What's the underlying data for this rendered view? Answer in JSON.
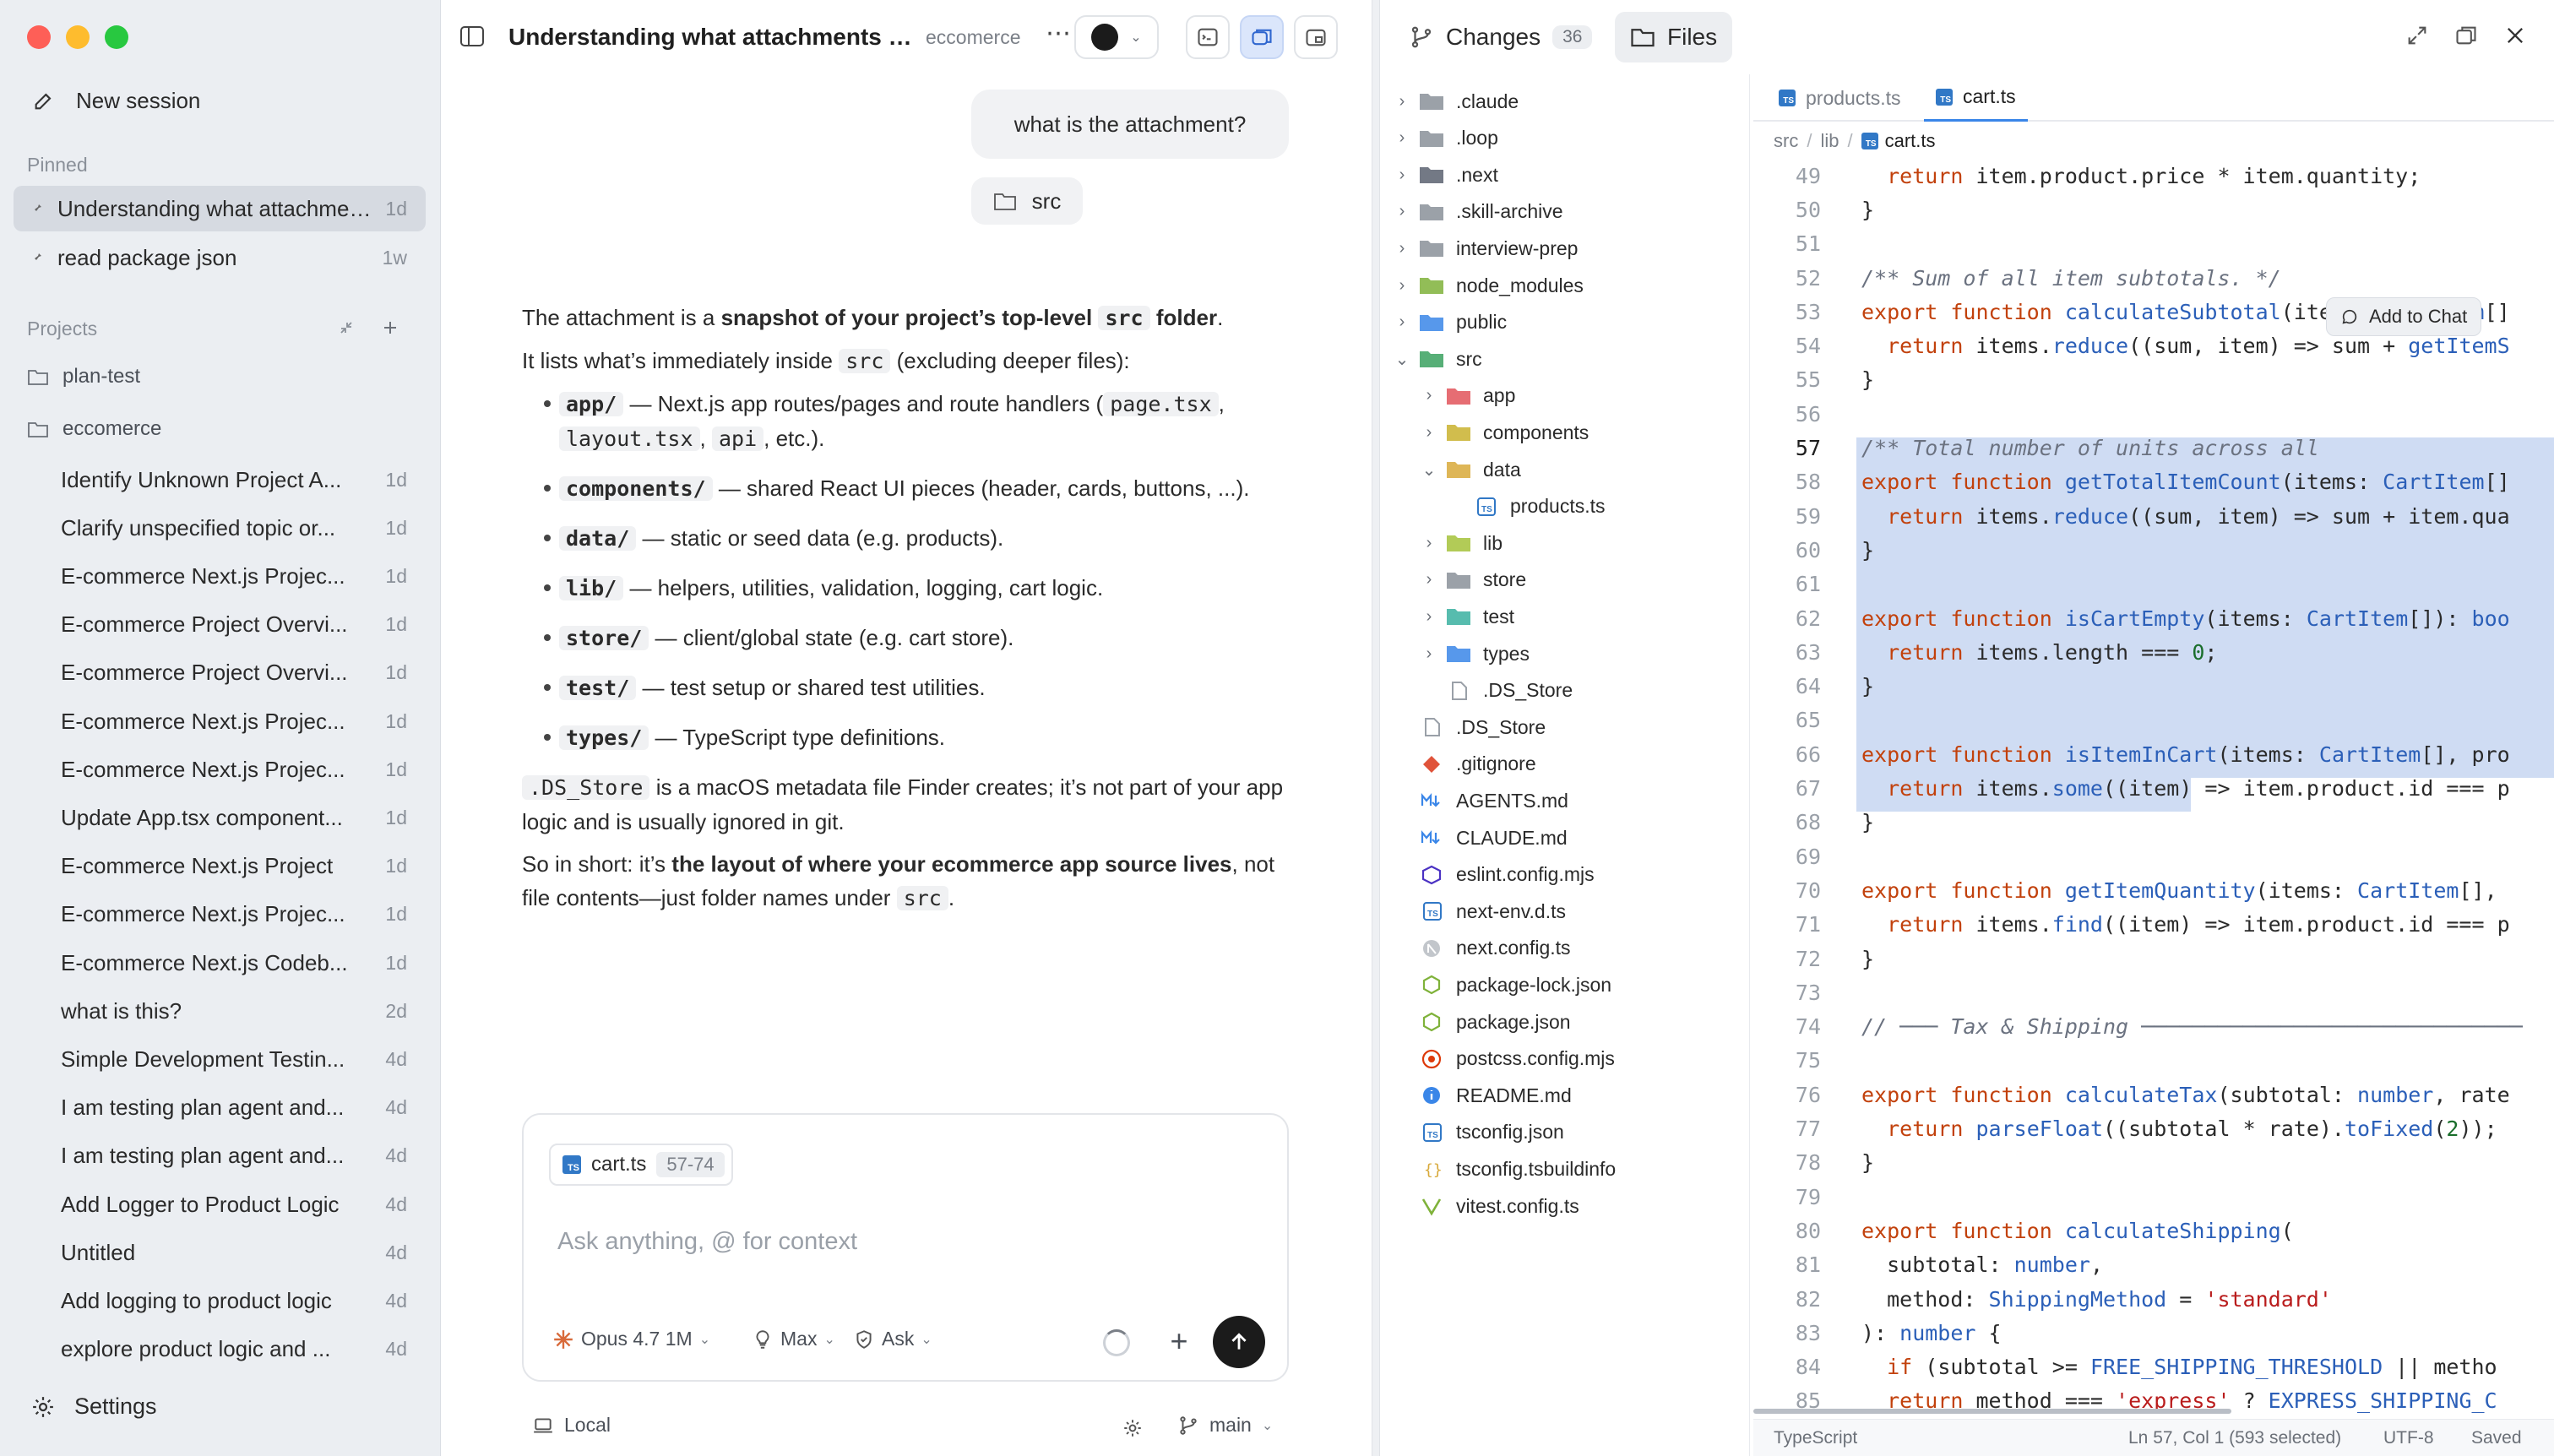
{
  "sidebar": {
    "new_session": "New session",
    "pinned_label": "Pinned",
    "pinned": [
      {
        "label": "Understanding what attachments refer to",
        "age": "1d",
        "active": true
      },
      {
        "label": "read package json",
        "age": "1w",
        "active": false
      }
    ],
    "projects_label": "Projects",
    "projects": [
      {
        "name": "plan-test"
      },
      {
        "name": "eccomerce"
      }
    ],
    "sessions": [
      {
        "label": "Identify Unknown Project A...",
        "age": "1d"
      },
      {
        "label": "Clarify unspecified topic or...",
        "age": "1d"
      },
      {
        "label": "E-commerce Next.js Projec...",
        "age": "1d"
      },
      {
        "label": "E-commerce Project Overvi...",
        "age": "1d"
      },
      {
        "label": "E-commerce Project Overvi...",
        "age": "1d"
      },
      {
        "label": "E-commerce Next.js Projec...",
        "age": "1d"
      },
      {
        "label": "E-commerce Next.js Projec...",
        "age": "1d"
      },
      {
        "label": "Update App.tsx component...",
        "age": "1d"
      },
      {
        "label": "E-commerce Next.js Project",
        "age": "1d"
      },
      {
        "label": "E-commerce Next.js Projec...",
        "age": "1d"
      },
      {
        "label": "E-commerce Next.js Codeb...",
        "age": "1d"
      },
      {
        "label": "what is this?",
        "age": "2d"
      },
      {
        "label": "Simple Development Testin...",
        "age": "4d"
      },
      {
        "label": "I am testing plan agent and...",
        "age": "4d"
      },
      {
        "label": "I am testing plan agent and...",
        "age": "4d"
      },
      {
        "label": "Add Logger to Product Logic",
        "age": "4d"
      },
      {
        "label": "Untitled",
        "age": "4d"
      },
      {
        "label": "Add logging to product logic",
        "age": "4d"
      },
      {
        "label": "explore product logic and ...",
        "age": "4d"
      }
    ],
    "settings": "Settings"
  },
  "chat": {
    "title": "Understanding what attachments re...",
    "project": "eccomerce",
    "user_message": "what is the attachment?",
    "attachment": "src",
    "answer": {
      "p1_pre": "The attachment is a ",
      "p1_bold": "snapshot of your project’s top-level",
      "p1_code": "src",
      "p1_bold2": "folder",
      "p1_end": ".",
      "p2_pre": "It lists what’s immediately inside",
      "p2_code": "src",
      "p2_post": "(excluding deeper files):",
      "items": [
        {
          "code": "app/",
          "text": "— Next.js app routes/pages and route handlers (",
          "codes": [
            "page.tsx",
            "layout.tsx",
            "api"
          ],
          "tail": ", etc.)."
        },
        {
          "code": "components/",
          "text": "— shared React UI pieces (header, cards, buttons, ...)."
        },
        {
          "code": "data/",
          "text": "— static or seed data (e.g. products)."
        },
        {
          "code": "lib/",
          "text": "— helpers, utilities, validation, logging, cart logic."
        },
        {
          "code": "store/",
          "text": "— client/global state (e.g. cart store)."
        },
        {
          "code": "test/",
          "text": "— test setup or shared test utilities."
        },
        {
          "code": "types/",
          "text": "— TypeScript type definitions."
        }
      ],
      "p3_code": ".DS_Store",
      "p3_text": "is a macOS metadata file Finder creates; it’s not part of your app logic and is usually ignored in git.",
      "p4_pre": "So in short: it’s",
      "p4_bold": "the layout of where your ecommerce app source lives",
      "p4_post": ", not file contents—just folder names under",
      "p4_code": "src",
      "p4_end": "."
    },
    "composer": {
      "context_file": "cart.ts",
      "context_range": "57-74",
      "placeholder": "Ask anything, @ for context",
      "model": "Opus 4.7 1M",
      "effort": "Max",
      "mode": "Ask"
    },
    "footer": {
      "location": "Local",
      "branch": "main"
    }
  },
  "files_panel": {
    "tabs": [
      {
        "label": "Changes",
        "count": "36"
      },
      {
        "label": "Files"
      }
    ],
    "tree": [
      {
        "name": ".claude",
        "type": "folder",
        "depth": 0,
        "expand": "closed",
        "color": "#8a9099"
      },
      {
        "name": ".loop",
        "type": "folder",
        "depth": 0,
        "expand": "closed",
        "color": "#8a9099"
      },
      {
        "name": ".next",
        "type": "folder",
        "depth": 0,
        "expand": "closed",
        "color": "#5b6270"
      },
      {
        "name": ".skill-archive",
        "type": "folder",
        "depth": 0,
        "expand": "closed",
        "color": "#8a9099"
      },
      {
        "name": "interview-prep",
        "type": "folder",
        "depth": 0,
        "expand": "closed",
        "color": "#8a9099"
      },
      {
        "name": "node_modules",
        "type": "folder",
        "depth": 0,
        "expand": "closed",
        "color": "#7fb23a"
      },
      {
        "name": "public",
        "type": "folder",
        "depth": 0,
        "expand": "closed",
        "color": "#3a86e8"
      },
      {
        "name": "src",
        "type": "folder",
        "depth": 0,
        "expand": "open",
        "color": "#3aa15f"
      },
      {
        "name": "app",
        "type": "folder",
        "depth": 1,
        "expand": "closed",
        "color": "#e2545b"
      },
      {
        "name": "components",
        "type": "folder",
        "depth": 1,
        "expand": "closed",
        "color": "#c9b12e"
      },
      {
        "name": "data",
        "type": "folder",
        "depth": 1,
        "expand": "open",
        "color": "#d8a93a"
      },
      {
        "name": "products.ts",
        "type": "ts",
        "depth": 2,
        "expand": "none",
        "color": "#3178c6"
      },
      {
        "name": "lib",
        "type": "folder",
        "depth": 1,
        "expand": "closed",
        "color": "#a5c23a"
      },
      {
        "name": "store",
        "type": "folder",
        "depth": 1,
        "expand": "closed",
        "color": "#8a9099"
      },
      {
        "name": "test",
        "type": "folder",
        "depth": 1,
        "expand": "closed",
        "color": "#3ab0a0"
      },
      {
        "name": "types",
        "type": "folder",
        "depth": 1,
        "expand": "closed",
        "color": "#3a86e8"
      },
      {
        "name": ".DS_Store",
        "type": "file",
        "depth": 1,
        "expand": "none",
        "color": "#9aa0a8"
      },
      {
        "name": ".DS_Store",
        "type": "file",
        "depth": 0,
        "expand": "none",
        "color": "#9aa0a8"
      },
      {
        "name": ".gitignore",
        "type": "git",
        "depth": 0,
        "expand": "none",
        "color": "#e0533a"
      },
      {
        "name": "AGENTS.md",
        "type": "md",
        "depth": 0,
        "expand": "none",
        "color": "#3a86e8"
      },
      {
        "name": "CLAUDE.md",
        "type": "md",
        "depth": 0,
        "expand": "none",
        "color": "#3a86e8"
      },
      {
        "name": "eslint.config.mjs",
        "type": "eslint",
        "depth": 0,
        "expand": "none",
        "color": "#4b32c3"
      },
      {
        "name": "next-env.d.ts",
        "type": "ts",
        "depth": 0,
        "expand": "none",
        "color": "#3178c6"
      },
      {
        "name": "next.config.ts",
        "type": "next",
        "depth": 0,
        "expand": "none",
        "color": "#9aa0a8"
      },
      {
        "name": "package-lock.json",
        "type": "npm",
        "depth": 0,
        "expand": "none",
        "color": "#7fb23a"
      },
      {
        "name": "package.json",
        "type": "npm",
        "depth": 0,
        "expand": "none",
        "color": "#7fb23a"
      },
      {
        "name": "postcss.config.mjs",
        "type": "postcss",
        "depth": 0,
        "expand": "none",
        "color": "#dd3a0a"
      },
      {
        "name": "README.md",
        "type": "info",
        "depth": 0,
        "expand": "none",
        "color": "#3a86e8"
      },
      {
        "name": "tsconfig.json",
        "type": "tsconfig",
        "depth": 0,
        "expand": "none",
        "color": "#3178c6"
      },
      {
        "name": "tsconfig.tsbuildinfo",
        "type": "braces",
        "depth": 0,
        "expand": "none",
        "color": "#d8a93a"
      },
      {
        "name": "vitest.config.ts",
        "type": "vitest",
        "depth": 0,
        "expand": "none",
        "color": "#7fb23a"
      }
    ],
    "editor_tabs": [
      {
        "label": "products.ts",
        "active": false
      },
      {
        "label": "cart.ts",
        "active": true
      }
    ],
    "breadcrumb": [
      "src",
      "lib",
      "cart.ts"
    ],
    "add_to_chat": "Add to Chat",
    "status": {
      "language": "TypeScript",
      "position": "Ln 57, Col 1 (593 selected)",
      "encoding": "UTF-8",
      "saved": "Saved"
    }
  }
}
